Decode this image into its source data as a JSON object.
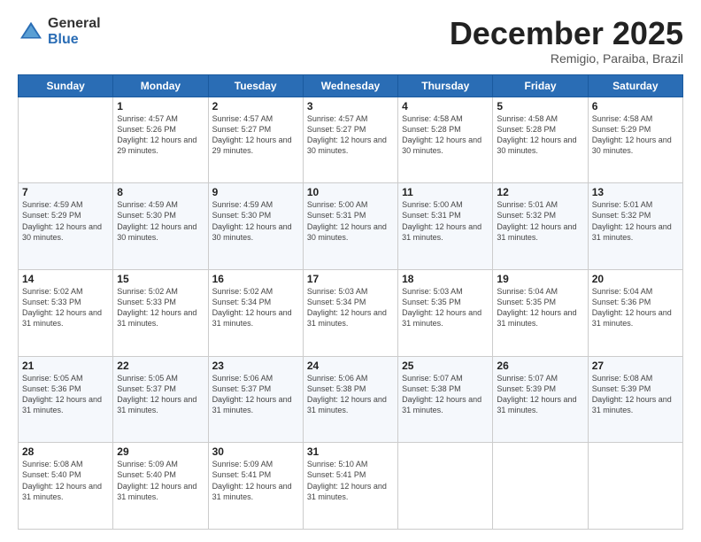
{
  "logo": {
    "general": "General",
    "blue": "Blue"
  },
  "header": {
    "month": "December 2025",
    "location": "Remigio, Paraiba, Brazil"
  },
  "weekdays": [
    "Sunday",
    "Monday",
    "Tuesday",
    "Wednesday",
    "Thursday",
    "Friday",
    "Saturday"
  ],
  "weeks": [
    [
      {
        "day": "",
        "empty": true
      },
      {
        "day": "1",
        "sunrise": "Sunrise: 4:57 AM",
        "sunset": "Sunset: 5:26 PM",
        "daylight": "Daylight: 12 hours and 29 minutes."
      },
      {
        "day": "2",
        "sunrise": "Sunrise: 4:57 AM",
        "sunset": "Sunset: 5:27 PM",
        "daylight": "Daylight: 12 hours and 29 minutes."
      },
      {
        "day": "3",
        "sunrise": "Sunrise: 4:57 AM",
        "sunset": "Sunset: 5:27 PM",
        "daylight": "Daylight: 12 hours and 30 minutes."
      },
      {
        "day": "4",
        "sunrise": "Sunrise: 4:58 AM",
        "sunset": "Sunset: 5:28 PM",
        "daylight": "Daylight: 12 hours and 30 minutes."
      },
      {
        "day": "5",
        "sunrise": "Sunrise: 4:58 AM",
        "sunset": "Sunset: 5:28 PM",
        "daylight": "Daylight: 12 hours and 30 minutes."
      },
      {
        "day": "6",
        "sunrise": "Sunrise: 4:58 AM",
        "sunset": "Sunset: 5:29 PM",
        "daylight": "Daylight: 12 hours and 30 minutes."
      }
    ],
    [
      {
        "day": "7",
        "sunrise": "Sunrise: 4:59 AM",
        "sunset": "Sunset: 5:29 PM",
        "daylight": "Daylight: 12 hours and 30 minutes."
      },
      {
        "day": "8",
        "sunrise": "Sunrise: 4:59 AM",
        "sunset": "Sunset: 5:30 PM",
        "daylight": "Daylight: 12 hours and 30 minutes."
      },
      {
        "day": "9",
        "sunrise": "Sunrise: 4:59 AM",
        "sunset": "Sunset: 5:30 PM",
        "daylight": "Daylight: 12 hours and 30 minutes."
      },
      {
        "day": "10",
        "sunrise": "Sunrise: 5:00 AM",
        "sunset": "Sunset: 5:31 PM",
        "daylight": "Daylight: 12 hours and 30 minutes."
      },
      {
        "day": "11",
        "sunrise": "Sunrise: 5:00 AM",
        "sunset": "Sunset: 5:31 PM",
        "daylight": "Daylight: 12 hours and 31 minutes."
      },
      {
        "day": "12",
        "sunrise": "Sunrise: 5:01 AM",
        "sunset": "Sunset: 5:32 PM",
        "daylight": "Daylight: 12 hours and 31 minutes."
      },
      {
        "day": "13",
        "sunrise": "Sunrise: 5:01 AM",
        "sunset": "Sunset: 5:32 PM",
        "daylight": "Daylight: 12 hours and 31 minutes."
      }
    ],
    [
      {
        "day": "14",
        "sunrise": "Sunrise: 5:02 AM",
        "sunset": "Sunset: 5:33 PM",
        "daylight": "Daylight: 12 hours and 31 minutes."
      },
      {
        "day": "15",
        "sunrise": "Sunrise: 5:02 AM",
        "sunset": "Sunset: 5:33 PM",
        "daylight": "Daylight: 12 hours and 31 minutes."
      },
      {
        "day": "16",
        "sunrise": "Sunrise: 5:02 AM",
        "sunset": "Sunset: 5:34 PM",
        "daylight": "Daylight: 12 hours and 31 minutes."
      },
      {
        "day": "17",
        "sunrise": "Sunrise: 5:03 AM",
        "sunset": "Sunset: 5:34 PM",
        "daylight": "Daylight: 12 hours and 31 minutes."
      },
      {
        "day": "18",
        "sunrise": "Sunrise: 5:03 AM",
        "sunset": "Sunset: 5:35 PM",
        "daylight": "Daylight: 12 hours and 31 minutes."
      },
      {
        "day": "19",
        "sunrise": "Sunrise: 5:04 AM",
        "sunset": "Sunset: 5:35 PM",
        "daylight": "Daylight: 12 hours and 31 minutes."
      },
      {
        "day": "20",
        "sunrise": "Sunrise: 5:04 AM",
        "sunset": "Sunset: 5:36 PM",
        "daylight": "Daylight: 12 hours and 31 minutes."
      }
    ],
    [
      {
        "day": "21",
        "sunrise": "Sunrise: 5:05 AM",
        "sunset": "Sunset: 5:36 PM",
        "daylight": "Daylight: 12 hours and 31 minutes."
      },
      {
        "day": "22",
        "sunrise": "Sunrise: 5:05 AM",
        "sunset": "Sunset: 5:37 PM",
        "daylight": "Daylight: 12 hours and 31 minutes."
      },
      {
        "day": "23",
        "sunrise": "Sunrise: 5:06 AM",
        "sunset": "Sunset: 5:37 PM",
        "daylight": "Daylight: 12 hours and 31 minutes."
      },
      {
        "day": "24",
        "sunrise": "Sunrise: 5:06 AM",
        "sunset": "Sunset: 5:38 PM",
        "daylight": "Daylight: 12 hours and 31 minutes."
      },
      {
        "day": "25",
        "sunrise": "Sunrise: 5:07 AM",
        "sunset": "Sunset: 5:38 PM",
        "daylight": "Daylight: 12 hours and 31 minutes."
      },
      {
        "day": "26",
        "sunrise": "Sunrise: 5:07 AM",
        "sunset": "Sunset: 5:39 PM",
        "daylight": "Daylight: 12 hours and 31 minutes."
      },
      {
        "day": "27",
        "sunrise": "Sunrise: 5:08 AM",
        "sunset": "Sunset: 5:39 PM",
        "daylight": "Daylight: 12 hours and 31 minutes."
      }
    ],
    [
      {
        "day": "28",
        "sunrise": "Sunrise: 5:08 AM",
        "sunset": "Sunset: 5:40 PM",
        "daylight": "Daylight: 12 hours and 31 minutes."
      },
      {
        "day": "29",
        "sunrise": "Sunrise: 5:09 AM",
        "sunset": "Sunset: 5:40 PM",
        "daylight": "Daylight: 12 hours and 31 minutes."
      },
      {
        "day": "30",
        "sunrise": "Sunrise: 5:09 AM",
        "sunset": "Sunset: 5:41 PM",
        "daylight": "Daylight: 12 hours and 31 minutes."
      },
      {
        "day": "31",
        "sunrise": "Sunrise: 5:10 AM",
        "sunset": "Sunset: 5:41 PM",
        "daylight": "Daylight: 12 hours and 31 minutes."
      },
      {
        "day": "",
        "empty": true
      },
      {
        "day": "",
        "empty": true
      },
      {
        "day": "",
        "empty": true
      }
    ]
  ]
}
